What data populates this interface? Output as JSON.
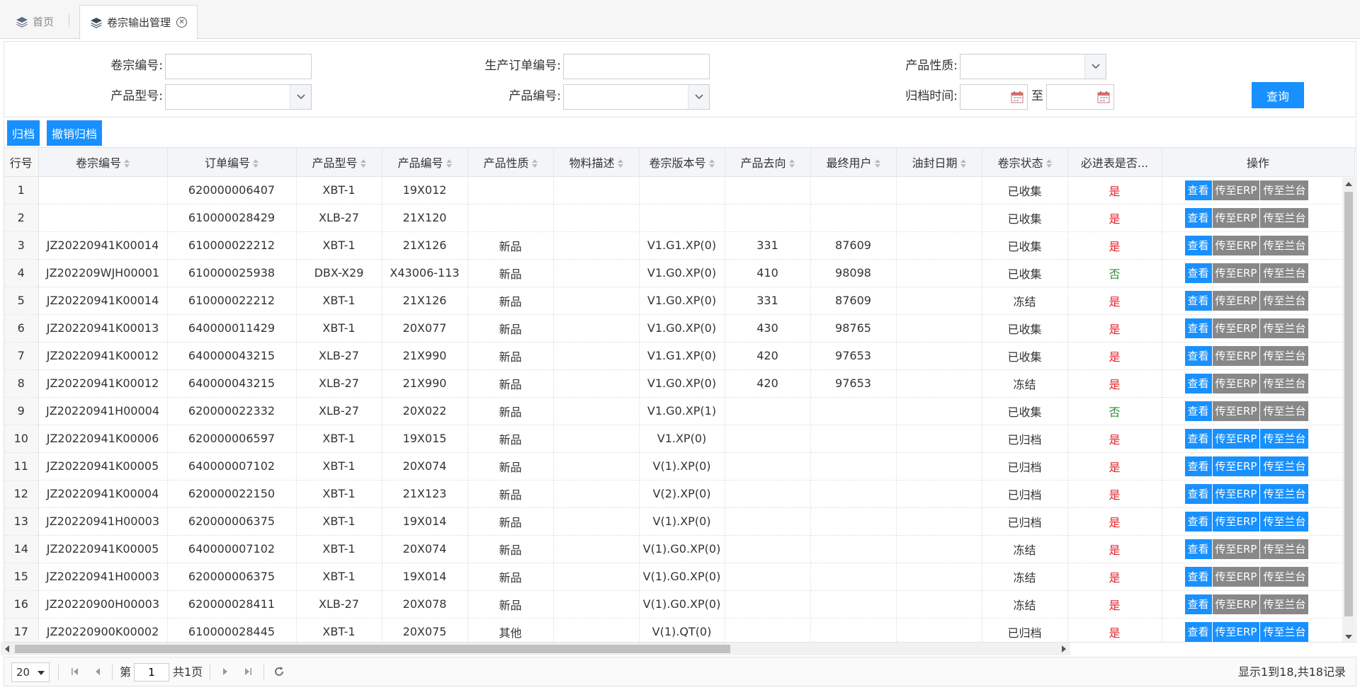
{
  "tabs": [
    {
      "label": "首页",
      "icon": "layers-icon"
    },
    {
      "label": "卷宗输出管理",
      "icon": "layers-icon"
    }
  ],
  "search": {
    "case_no_label": "卷宗编号:",
    "order_no_label": "生产订单编号:",
    "nature_label": "产品性质:",
    "model_label": "产品型号:",
    "product_no_label": "产品编号:",
    "archive_time_label": "归档时间:",
    "to_label": "至",
    "query_label": "查询"
  },
  "toolbar": {
    "archive_label": "归档",
    "unarchive_label": "撤销归档"
  },
  "columns": [
    "行号",
    "卷宗编号",
    "订单编号",
    "产品型号",
    "产品编号",
    "产品性质",
    "物料描述",
    "卷宗版本号",
    "产品去向",
    "最终用户",
    "油封日期",
    "卷宗状态",
    "必进表是否...",
    "操作"
  ],
  "row_actions": {
    "view": "查看",
    "to_erp": "传至ERP",
    "to_lantai": "传至兰台"
  },
  "rows": [
    {
      "no": "1",
      "case": "",
      "order": "620000006407",
      "model": "XBT-1",
      "product": "19X012",
      "nature": "",
      "desc": "",
      "version": "",
      "dest": "",
      "user": "",
      "seal": "",
      "status": "已收集",
      "must": "是",
      "erp_active": false,
      "lt_active": false
    },
    {
      "no": "2",
      "case": "",
      "order": "610000028429",
      "model": "XLB-27",
      "product": "21X120",
      "nature": "",
      "desc": "",
      "version": "",
      "dest": "",
      "user": "",
      "seal": "",
      "status": "已收集",
      "must": "是",
      "erp_active": false,
      "lt_active": false
    },
    {
      "no": "3",
      "case": "JZ20220941K00014",
      "order": "610000022212",
      "model": "XBT-1",
      "product": "21X126",
      "nature": "新品",
      "desc": "",
      "version": "V1.G1.XP(0)",
      "dest": "331",
      "user": "87609",
      "seal": "",
      "status": "已收集",
      "must": "是",
      "erp_active": false,
      "lt_active": false
    },
    {
      "no": "4",
      "case": "JZ202209WJH00001",
      "order": "610000025938",
      "model": "DBX-X29",
      "product": "X43006-113",
      "nature": "新品",
      "desc": "",
      "version": "V1.G0.XP(0)",
      "dest": "410",
      "user": "98098",
      "seal": "",
      "status": "已收集",
      "must": "否",
      "erp_active": false,
      "lt_active": false
    },
    {
      "no": "5",
      "case": "JZ20220941K00014",
      "order": "610000022212",
      "model": "XBT-1",
      "product": "21X126",
      "nature": "新品",
      "desc": "",
      "version": "V1.G0.XP(0)",
      "dest": "331",
      "user": "87609",
      "seal": "",
      "status": "冻结",
      "must": "是",
      "erp_active": false,
      "lt_active": false
    },
    {
      "no": "6",
      "case": "JZ20220941K00013",
      "order": "640000011429",
      "model": "XBT-1",
      "product": "20X077",
      "nature": "新品",
      "desc": "",
      "version": "V1.G0.XP(0)",
      "dest": "430",
      "user": "98765",
      "seal": "",
      "status": "已收集",
      "must": "是",
      "erp_active": false,
      "lt_active": false
    },
    {
      "no": "7",
      "case": "JZ20220941K00012",
      "order": "640000043215",
      "model": "XLB-27",
      "product": "21X990",
      "nature": "新品",
      "desc": "",
      "version": "V1.G1.XP(0)",
      "dest": "420",
      "user": "97653",
      "seal": "",
      "status": "已收集",
      "must": "是",
      "erp_active": false,
      "lt_active": false
    },
    {
      "no": "8",
      "case": "JZ20220941K00012",
      "order": "640000043215",
      "model": "XLB-27",
      "product": "21X990",
      "nature": "新品",
      "desc": "",
      "version": "V1.G0.XP(0)",
      "dest": "420",
      "user": "97653",
      "seal": "",
      "status": "冻结",
      "must": "是",
      "erp_active": false,
      "lt_active": false
    },
    {
      "no": "9",
      "case": "JZ20220941H00004",
      "order": "620000022332",
      "model": "XLB-27",
      "product": "20X022",
      "nature": "新品",
      "desc": "",
      "version": "V1.G0.XP(1)",
      "dest": "",
      "user": "",
      "seal": "",
      "status": "已收集",
      "must": "否",
      "erp_active": false,
      "lt_active": false
    },
    {
      "no": "10",
      "case": "JZ20220941K00006",
      "order": "620000006597",
      "model": "XBT-1",
      "product": "19X015",
      "nature": "新品",
      "desc": "",
      "version": "V1.XP(0)",
      "dest": "",
      "user": "",
      "seal": "",
      "status": "已归档",
      "must": "是",
      "erp_active": true,
      "lt_active": true
    },
    {
      "no": "11",
      "case": "JZ20220941K00005",
      "order": "640000007102",
      "model": "XBT-1",
      "product": "20X074",
      "nature": "新品",
      "desc": "",
      "version": "V(1).XP(0)",
      "dest": "",
      "user": "",
      "seal": "",
      "status": "已归档",
      "must": "是",
      "erp_active": true,
      "lt_active": true
    },
    {
      "no": "12",
      "case": "JZ20220941K00004",
      "order": "620000022150",
      "model": "XBT-1",
      "product": "21X123",
      "nature": "新品",
      "desc": "",
      "version": "V(2).XP(0)",
      "dest": "",
      "user": "",
      "seal": "",
      "status": "已归档",
      "must": "是",
      "erp_active": true,
      "lt_active": true
    },
    {
      "no": "13",
      "case": "JZ20220941H00003",
      "order": "620000006375",
      "model": "XBT-1",
      "product": "19X014",
      "nature": "新品",
      "desc": "",
      "version": "V(1).XP(0)",
      "dest": "",
      "user": "",
      "seal": "",
      "status": "已归档",
      "must": "是",
      "erp_active": true,
      "lt_active": true
    },
    {
      "no": "14",
      "case": "JZ20220941K00005",
      "order": "640000007102",
      "model": "XBT-1",
      "product": "20X074",
      "nature": "新品",
      "desc": "",
      "version": "V(1).G0.XP(0)",
      "dest": "",
      "user": "",
      "seal": "",
      "status": "冻结",
      "must": "是",
      "erp_active": false,
      "lt_active": false
    },
    {
      "no": "15",
      "case": "JZ20220941H00003",
      "order": "620000006375",
      "model": "XBT-1",
      "product": "19X014",
      "nature": "新品",
      "desc": "",
      "version": "V(1).G0.XP(0)",
      "dest": "",
      "user": "",
      "seal": "",
      "status": "冻结",
      "must": "是",
      "erp_active": false,
      "lt_active": false
    },
    {
      "no": "16",
      "case": "JZ20220900H00003",
      "order": "620000028411",
      "model": "XLB-27",
      "product": "20X078",
      "nature": "新品",
      "desc": "",
      "version": "V(1).G0.XP(0)",
      "dest": "",
      "user": "",
      "seal": "",
      "status": "冻结",
      "must": "是",
      "erp_active": false,
      "lt_active": false
    },
    {
      "no": "17",
      "case": "JZ20220900K00002",
      "order": "610000028445",
      "model": "XBT-1",
      "product": "20X075",
      "nature": "其他",
      "desc": "",
      "version": "V(1).QT(0)",
      "dest": "",
      "user": "",
      "seal": "",
      "status": "已归档",
      "must": "是",
      "erp_active": true,
      "lt_active": true
    }
  ],
  "pager": {
    "page_size": "20",
    "page_prefix": "第",
    "page_current": "1",
    "page_total": "共1页",
    "info": "显示1到18,共18记录"
  },
  "colors": {
    "primary": "#1890ff",
    "disabled": "#888888",
    "yes": "#e5232a",
    "no": "#2e8b2e"
  }
}
